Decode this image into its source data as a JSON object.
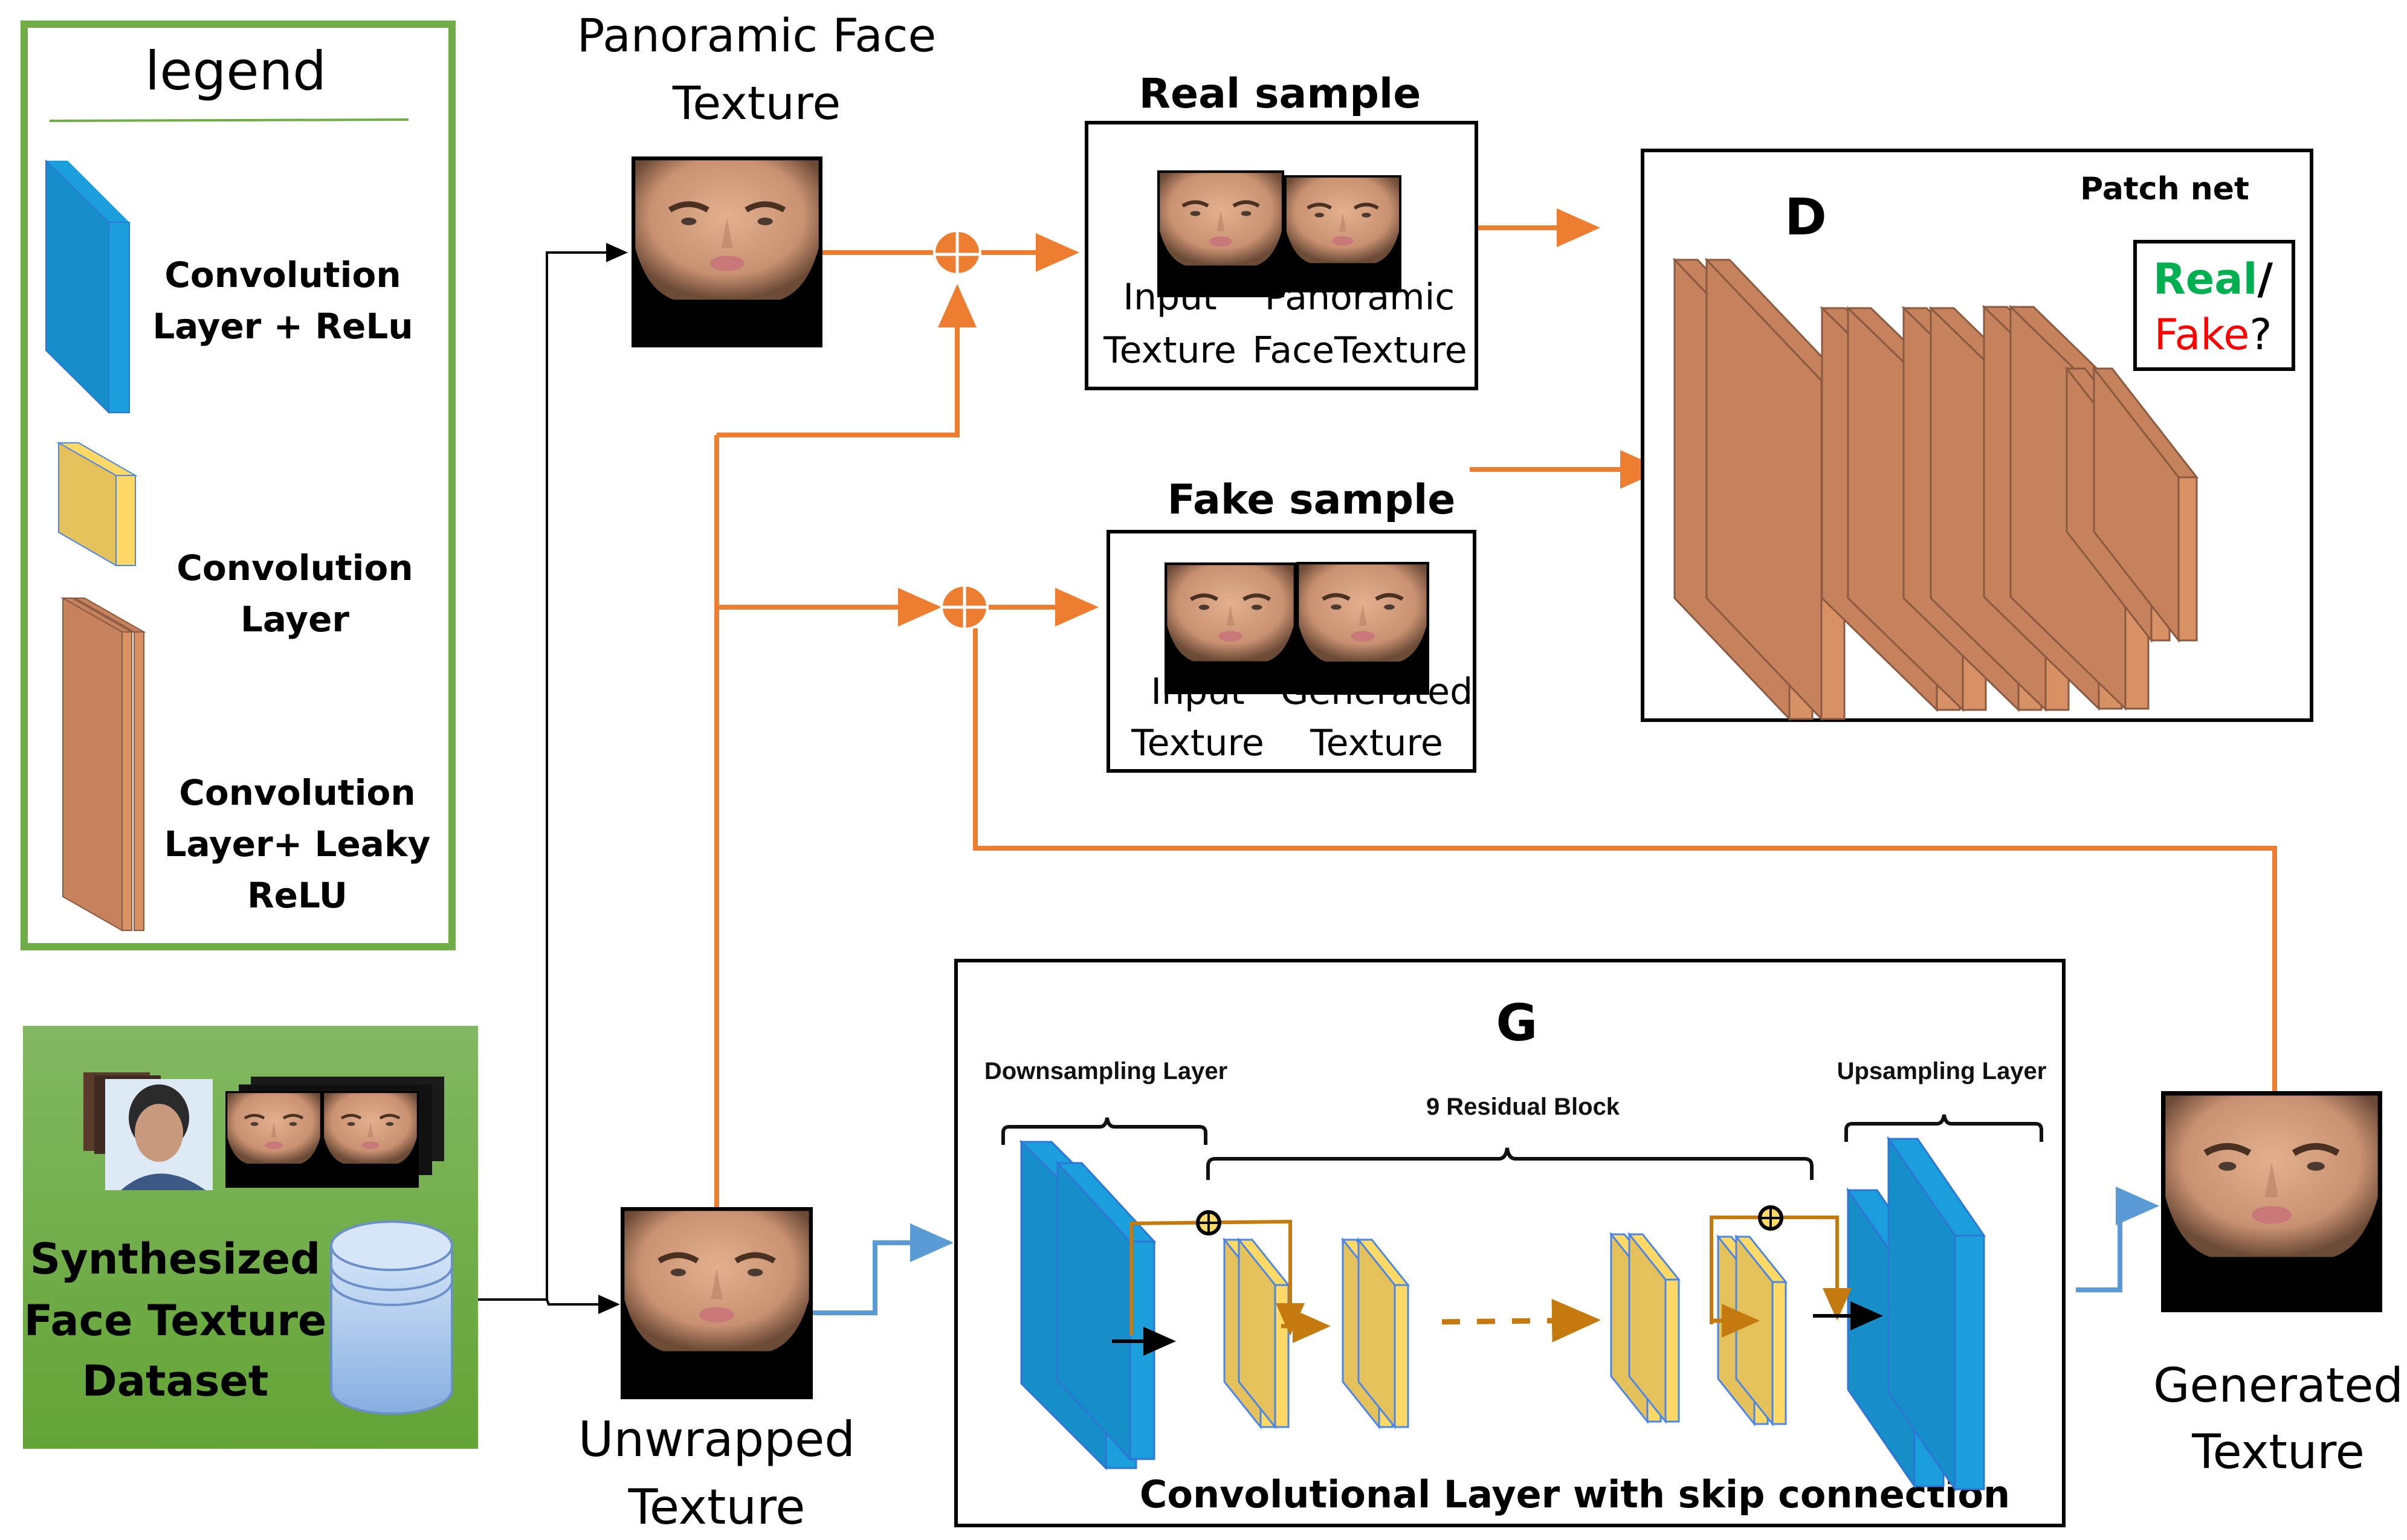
{
  "colors": {
    "orange": "#ED7D31",
    "green_border": "#70AD47",
    "green_fill": "#6FAE3F",
    "blue_layer": "#1A9EDC",
    "blue_layer_dark": "#168EC7",
    "yellow_layer": "#E5C15C",
    "yellow_layer_light": "#FFD966",
    "brown_layer": "#C5825D",
    "brown_layer_light": "#D89065",
    "skip_arrow": "#C47A0E",
    "blue_arrow": "#5B9BD5",
    "real_green": "#00B050",
    "fake_red": "#FF0000"
  },
  "legend": {
    "title": "legend",
    "items": [
      {
        "icon": "blue-conv-relu-layer",
        "line1": "Convolution",
        "line2": "Layer + ReLu"
      },
      {
        "icon": "yellow-conv-layer",
        "line1": "Convolution",
        "line2": "Layer"
      },
      {
        "icon": "brown-conv-leaky-layer",
        "line1": "Convolution",
        "line2": "Layer+ Leaky",
        "line3": "ReLU"
      }
    ]
  },
  "dataset": {
    "line1": "Synthesized",
    "line2": "Face Texture",
    "line3": "Dataset",
    "icon": "database-cylinder"
  },
  "panoramic": {
    "line1": "Panoramic Face",
    "line2": "Texture"
  },
  "unwrapped": {
    "line1": "Unwrapped",
    "line2": "Texture"
  },
  "generated": {
    "line1": "Generated",
    "line2": "Texture"
  },
  "real_sample": {
    "title": "Real sample",
    "left_label1": "Input",
    "left_label2": "Texture",
    "right_label1": "Panoramic",
    "right_label2": "FaceTexture"
  },
  "fake_sample": {
    "title": "Fake sample",
    "left_label1": "Input",
    "left_label2": "Texture",
    "right_label1": "Generated",
    "right_label2": "Texture"
  },
  "discriminator": {
    "label": "D",
    "subtitle": "Patch net",
    "output_real": "Real",
    "output_slash": "/",
    "output_fake": "Fake",
    "output_q": "?"
  },
  "generator": {
    "label": "G",
    "downsampling": "Downsampling Layer",
    "residual": "9 Residual Block",
    "upsampling": "Upsampling Layer",
    "caption": "Convolutional Layer with skip connection"
  }
}
